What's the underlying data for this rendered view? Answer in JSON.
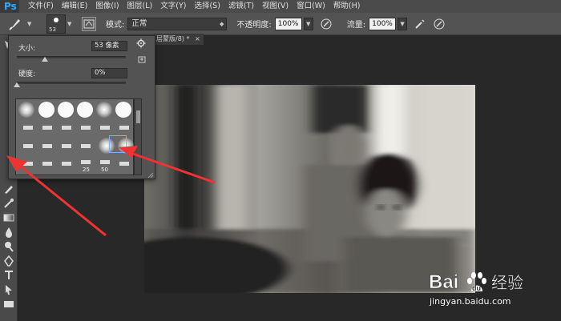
{
  "app": {
    "logo": "Ps"
  },
  "menu": [
    "文件(F)",
    "编辑(E)",
    "图像(I)",
    "图层(L)",
    "文字(Y)",
    "选择(S)",
    "滤镜(T)",
    "视图(V)",
    "窗口(W)",
    "帮助(H)"
  ],
  "options": {
    "brush_size": "53",
    "mode_label": "模式:",
    "mode_value": "正常",
    "opacity_label": "不透明度:",
    "opacity_value": "100%",
    "flow_label": "流量:",
    "flow_value": "100%"
  },
  "document_tab": {
    "title": "层蒙版/8) *",
    "close": "×"
  },
  "brush_panel": {
    "size_label": "大小:",
    "size_value": "53 像素",
    "size_fraction": 0.26,
    "hardness_label": "硬度:",
    "hardness_value": "0%",
    "hardness_fraction": 0.0,
    "preset_numbers": [
      "25",
      "50"
    ]
  },
  "watermark": {
    "brand": "Bai",
    "paw": "du",
    "service": "经验",
    "url": "jingyan.baidu.com"
  },
  "colors": {
    "accent": "#31a8ff",
    "arrow": "#ee3333",
    "selection": "#7fb0ff"
  }
}
